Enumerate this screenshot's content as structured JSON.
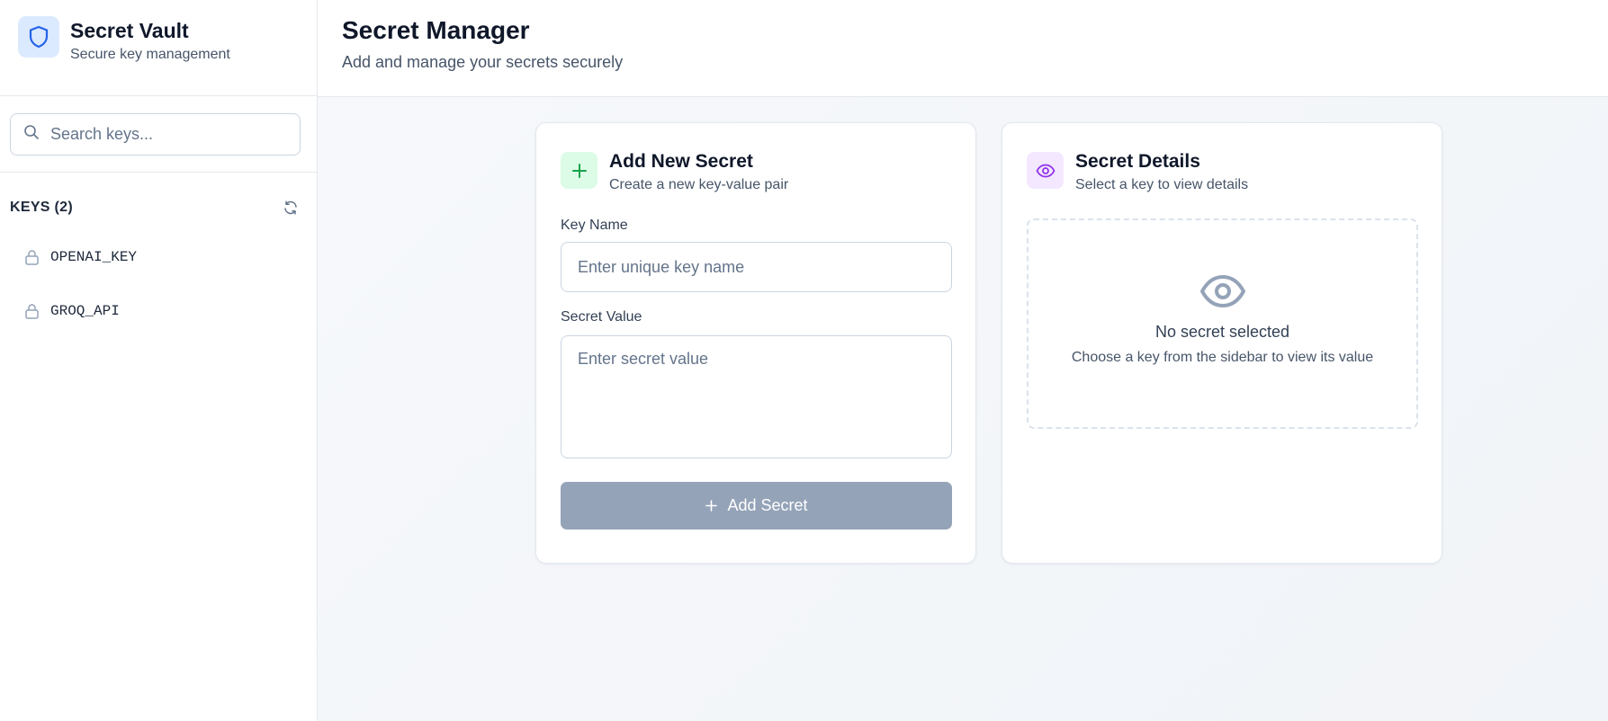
{
  "sidebar": {
    "brand_title": "Secret Vault",
    "brand_subtitle": "Secure key management",
    "search_placeholder": "Search keys...",
    "keys_heading": "KEYS (2)",
    "keys": [
      {
        "label": "OPENAI_KEY",
        "icon": "lock-icon"
      },
      {
        "label": "GROQ_API",
        "icon": "lock-icon"
      }
    ]
  },
  "header": {
    "title": "Secret Manager",
    "subtitle": "Add and manage your secrets securely"
  },
  "add_card": {
    "title": "Add New Secret",
    "subtitle": "Create a new key-value pair",
    "key_label": "Key Name",
    "key_placeholder": "Enter unique key name",
    "value_label": "Secret Value",
    "value_placeholder": "Enter secret value",
    "button_label": "Add Secret"
  },
  "details_card": {
    "title": "Secret Details",
    "subtitle": "Select a key to view details",
    "empty_title": "No secret selected",
    "empty_subtitle": "Choose a key from the sidebar to view its value"
  },
  "colors": {
    "accent_blue": "#2563eb",
    "accent_green": "#16a34a",
    "accent_purple": "#9333ea",
    "disabled_button": "#94a3b8"
  }
}
